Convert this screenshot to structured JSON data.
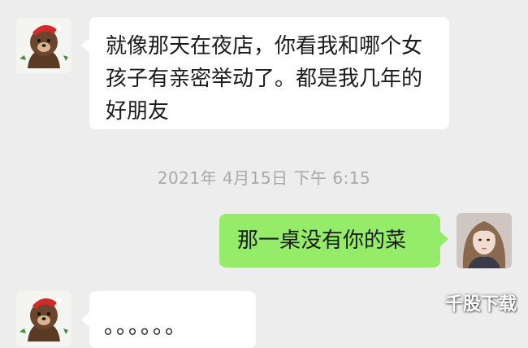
{
  "chat": {
    "messages": [
      {
        "sender": "contact",
        "text": "就像那天在夜店，你看我和哪个女孩子有亲密举动了。都是我几年的好朋友"
      },
      {
        "sender": "self",
        "text": "那一桌没有你的菜"
      },
      {
        "sender": "contact",
        "text": "。。。。。。"
      }
    ],
    "timestamp": "2021年 4月15日 下午 6:15"
  },
  "watermark": "千股下载",
  "colors": {
    "background": "#ededed",
    "incoming_bubble": "#ffffff",
    "outgoing_bubble": "#95ec69",
    "timestamp_text": "#a9a9a9"
  },
  "icons": {
    "contact_avatar": "brown-bear-santa-hat-avatar",
    "self_avatar": "girl-photo-avatar"
  }
}
